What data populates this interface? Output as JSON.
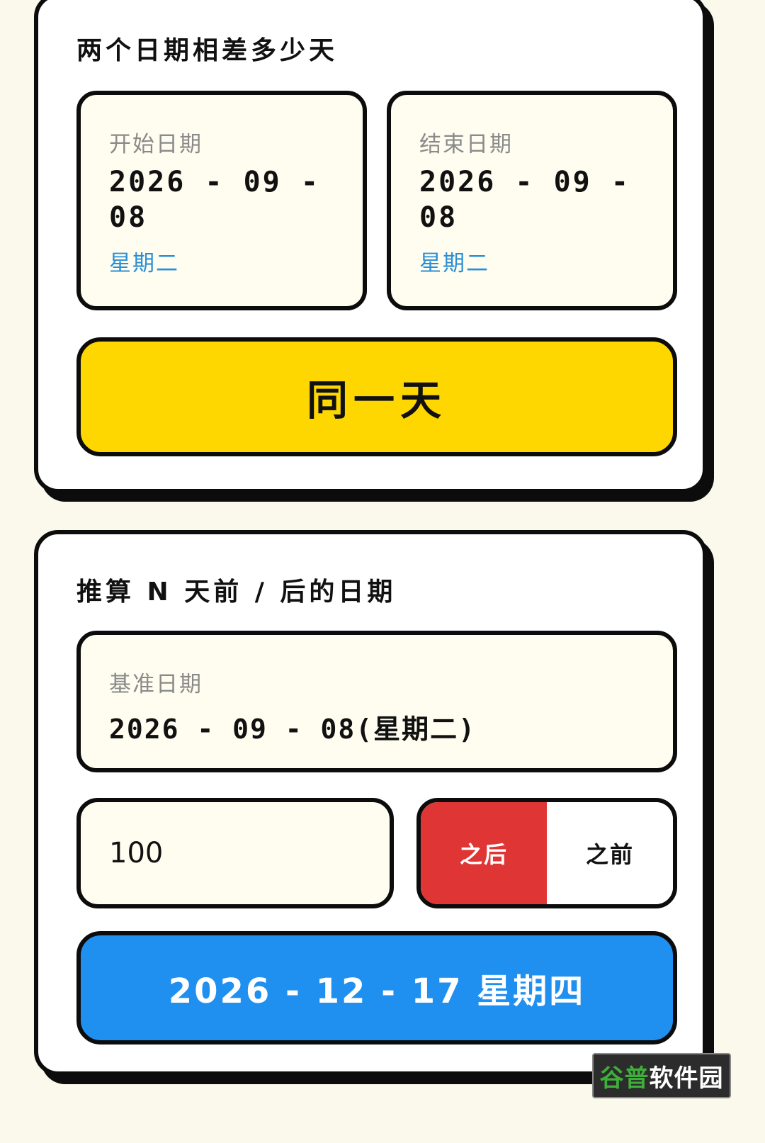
{
  "colors": {
    "page_background": "#fbf9ec",
    "same_day_bar": "#ffd700",
    "result_bar": "#2090f0",
    "toggle_active": "#e03535",
    "weekday_text": "#2a8fd6"
  },
  "date_diff": {
    "title": "两个日期相差多少天",
    "start": {
      "label": "开始日期",
      "date": "2026 - 09 - 08",
      "weekday": "星期二"
    },
    "end": {
      "label": "结束日期",
      "date": "2026 - 09 - 08",
      "weekday": "星期二"
    },
    "result": "同一天"
  },
  "offset_calc": {
    "title": "推算 N 天前 / 后的日期",
    "base": {
      "label": "基准日期",
      "value": "2026 - 09 - 08(星期二)"
    },
    "days_input": {
      "value": "100"
    },
    "direction": {
      "after_label": "之后",
      "before_label": "之前",
      "selected": "之后"
    },
    "result": "2026 - 12 - 17 星期四"
  },
  "watermark": {
    "part1": "谷普",
    "part2": "软件园"
  }
}
